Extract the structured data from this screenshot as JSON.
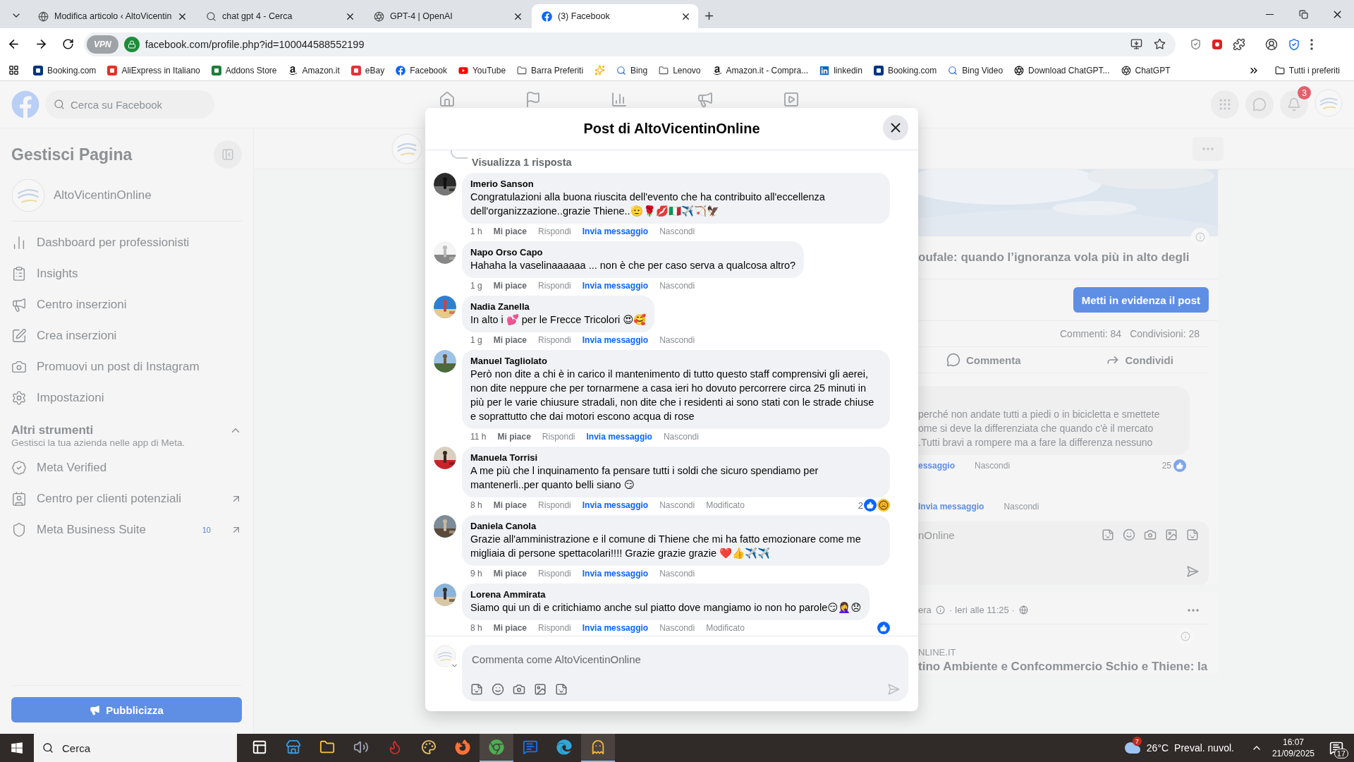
{
  "browser": {
    "tabs": [
      {
        "title": "Modifica articolo ‹ AltoVicentin",
        "selected": false
      },
      {
        "title": "chat gpt 4 - Cerca",
        "selected": false
      },
      {
        "title": "GPT-4 | OpenAI",
        "selected": false
      },
      {
        "title": "(3) Facebook",
        "selected": true
      }
    ],
    "vpn_badge": "VPN",
    "address": "facebook.com/profile.php?id=100044588552199",
    "bookmarks": [
      {
        "kind": "link",
        "label": "Booking.com"
      },
      {
        "kind": "link",
        "label": "AliExpress in Italiano"
      },
      {
        "kind": "link",
        "label": "Addons Store"
      },
      {
        "kind": "link",
        "label": "Amazon.it"
      },
      {
        "kind": "link",
        "label": "eBay"
      },
      {
        "kind": "link",
        "label": "Facebook"
      },
      {
        "kind": "link",
        "label": "YouTube"
      },
      {
        "kind": "folder",
        "label": "Barra Preferiti"
      },
      {
        "kind": "icon"
      },
      {
        "kind": "link",
        "label": "Bing"
      },
      {
        "kind": "folder",
        "label": "Lenovo"
      },
      {
        "kind": "link",
        "label": "Amazon.it - Compra..."
      },
      {
        "kind": "link",
        "label": "linkedin"
      },
      {
        "kind": "link",
        "label": "Booking.com"
      },
      {
        "kind": "link",
        "label": "Bing Video"
      },
      {
        "kind": "link",
        "label": "Download ChatGPT..."
      },
      {
        "kind": "link",
        "label": "ChatGPT"
      }
    ],
    "all_bookmarks": "Tutti i preferiti"
  },
  "facebook": {
    "search": {
      "placeholder": "Cerca su Facebook"
    },
    "notifications_badge": "3",
    "sidebar": {
      "title": "Gestisci Pagina",
      "page_name": "AltoVicentinOnline",
      "items": [
        {
          "label": "Dashboard per professionisti"
        },
        {
          "label": "Insights"
        },
        {
          "label": "Centro inserzioni"
        },
        {
          "label": "Crea inserzioni"
        },
        {
          "label": "Promuovi un post di Instagram"
        },
        {
          "label": "Impostazioni"
        }
      ],
      "tools_title": "Altri strumenti",
      "tools_expanded": true,
      "tools_subtitle": "Gestisci la tua azienda nelle app di Meta.",
      "tools": [
        {
          "label": "Meta Verified",
          "external": false
        },
        {
          "label": "Centro per clienti potenziali",
          "external": true
        },
        {
          "label": "Meta Business Suite",
          "external": true,
          "badge": "10"
        }
      ],
      "promote_button": "Pubblicizza"
    },
    "background_post": {
      "headline": "oufale: quando l’ignoranza vola più in alto degli",
      "boost_button": "Metti in evidenza il post",
      "comments_count": "Commenti: 84",
      "shares_count": "Condivisioni: 28",
      "comment_action": "Commenta",
      "share_action": "Condividi",
      "comment_lines": [
        "perché non andate tutti a piedi o in bicicletta e smettete",
        "ome si deve la differenziata che quando c'è il mercato",
        ".Tutti bravi a rompere ma a fare la differenza nessuno"
      ],
      "comment_message_link": "essaggio",
      "comment_hide": "Nascondi",
      "comment_reactions": "25",
      "reply_message_link": "Invia messaggio",
      "reply_hide": "Nascondi",
      "composer_placeholder": "nOnline"
    },
    "next_post": {
      "author": "era",
      "meta": "· Ieri alle 11:25 ·",
      "source": "NLINE.IT",
      "headline": "tino Ambiente e Confcommercio Schio e Thiene: la"
    },
    "dialog": {
      "title": "Post di AltoVicentinOnline",
      "view_replies": "Visualizza 1 risposta",
      "comments": [
        {
          "author": "Imerio Sanson",
          "text": "Congratulazioni alla buona riuscita dell'evento che ha contribuito all'eccellenza dell'organizzazione..grazie Thiene..🫡🌹💋🇮🇹✈️🏹🦅",
          "time": "1 h",
          "actions": [
            {
              "kind": "like",
              "label": "Mi piace"
            },
            {
              "kind": "reply",
              "label": "Rispondi"
            },
            {
              "kind": "message",
              "label": "Invia messaggio"
            },
            {
              "kind": "hide",
              "label": "Nascondi"
            }
          ]
        },
        {
          "author": "Napo Orso Capo",
          "text": "Hahaha la vaselinaaaaaa ... non è che per caso serva a qualcosa altro?",
          "time": "1 g",
          "actions": [
            {
              "kind": "like",
              "label": "Mi piace"
            },
            {
              "kind": "reply",
              "label": "Rispondi"
            },
            {
              "kind": "message",
              "label": "Invia messaggio"
            },
            {
              "kind": "hide",
              "label": "Nascondi"
            }
          ]
        },
        {
          "author": "Nadia Zanella",
          "text": "In alto i 💕 per le Frecce Tricolori 😍🥰",
          "time": "1 g",
          "actions": [
            {
              "kind": "like",
              "label": "Mi piace"
            },
            {
              "kind": "reply",
              "label": "Rispondi"
            },
            {
              "kind": "message",
              "label": "Invia messaggio"
            },
            {
              "kind": "hide",
              "label": "Nascondi"
            }
          ]
        },
        {
          "author": "Manuel Tagliolato",
          "text": "Però non dite a chi è in carico il mantenimento di tutto questo staff comprensivi gli aerei, non dite neppure che per tornarmene a casa ieri ho dovuto percorrere circa 25 minuti in più per le varie chiusure stradali, non dite che i residenti ai sono stati con le strade chiuse e soprattutto che dai motori escono acqua di rose",
          "time": "11 h",
          "actions": [
            {
              "kind": "like",
              "label": "Mi piace"
            },
            {
              "kind": "reply",
              "label": "Rispondi"
            },
            {
              "kind": "message",
              "label": "Invia messaggio"
            },
            {
              "kind": "hide",
              "label": "Nascondi"
            }
          ]
        },
        {
          "author": "Manuela Torrisi",
          "text": "A me più che l inquinamento fa pensare tutti i soldi che sicuro spendiamo per mantenerli..per quanto belli siano 😏",
          "time": "8 h",
          "actions": [
            {
              "kind": "like",
              "label": "Mi piace"
            },
            {
              "kind": "reply",
              "label": "Rispondi"
            },
            {
              "kind": "message",
              "label": "Invia messaggio"
            },
            {
              "kind": "hide",
              "label": "Nascondi"
            },
            {
              "kind": "edited",
              "label": "Modificato"
            }
          ],
          "reaction_count": "2",
          "reactions": [
            {
              "kind": "like"
            },
            {
              "kind": "sad"
            }
          ]
        },
        {
          "author": "Daniela Canola",
          "text": "Grazie all'amministrazione e il comune di Thiene che mi ha fatto emozionare come me migliaia di persone spettacolari!!!! Grazie grazie grazie ❤️👍✈️✈️",
          "time": "9 h",
          "actions": [
            {
              "kind": "like",
              "label": "Mi piace"
            },
            {
              "kind": "reply",
              "label": "Rispondi"
            },
            {
              "kind": "message",
              "label": "Invia messaggio"
            },
            {
              "kind": "hide",
              "label": "Nascondi"
            }
          ]
        },
        {
          "author": "Lorena Ammirata",
          "text": "Siamo qui un di e critichiamo anche sul piatto dove mangiamo io non ho parole😏🤦‍♀️😞",
          "time": "8 h",
          "actions": [
            {
              "kind": "like",
              "label": "Mi piace"
            },
            {
              "kind": "reply",
              "label": "Rispondi"
            },
            {
              "kind": "message",
              "label": "Invia messaggio"
            },
            {
              "kind": "hide",
              "label": "Nascondi"
            },
            {
              "kind": "edited",
              "label": "Modificato"
            }
          ],
          "reactions": [
            {
              "kind": "like"
            }
          ]
        }
      ],
      "composer": {
        "placeholder": "Commenta come AltoVicentinOnline"
      }
    }
  },
  "taskbar": {
    "search": "Cerca",
    "apps": [
      {
        "open": false
      },
      {
        "open": false
      },
      {
        "open": false
      },
      {
        "open": false
      },
      {
        "open": false
      },
      {
        "open": false
      },
      {
        "open": false
      },
      {
        "open": true
      },
      {
        "open": false
      },
      {
        "open": false
      },
      {
        "open": true
      }
    ],
    "weather_badge": "7",
    "temperature": "26°C",
    "condition": "Preval. nuvol.",
    "time": "16:07",
    "date": "21/09/2025",
    "notifications": "17"
  }
}
